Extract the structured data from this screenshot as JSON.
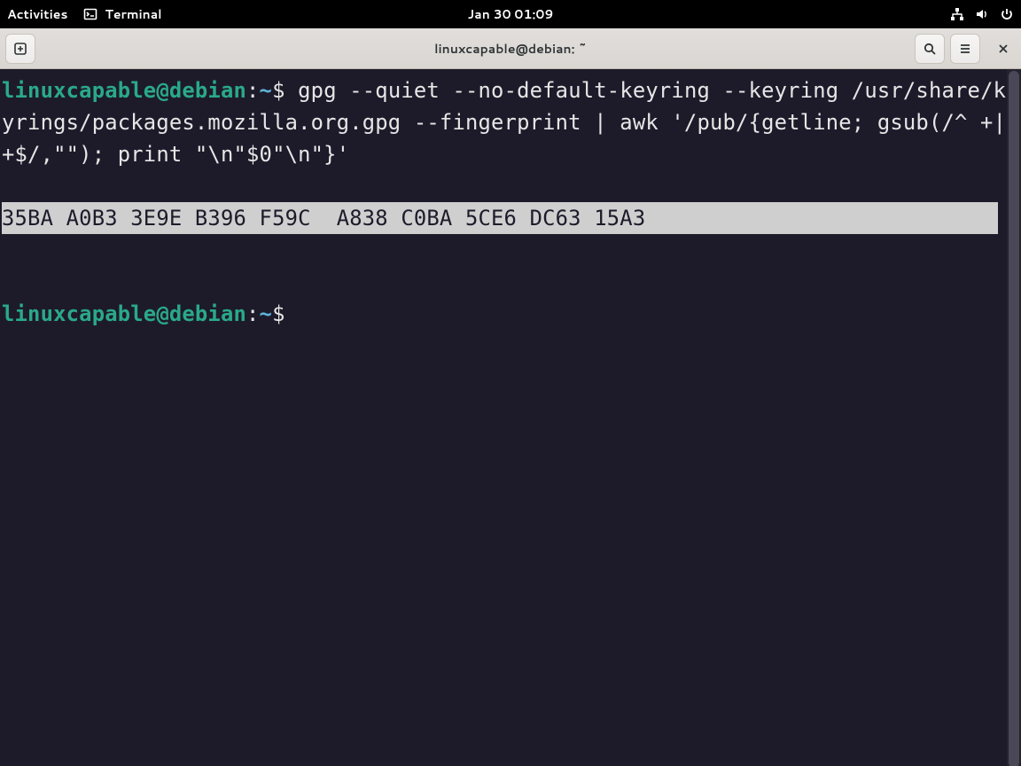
{
  "topbar": {
    "activities": "Activities",
    "app_label": "Terminal",
    "clock": "Jan 30  01:09"
  },
  "headerbar": {
    "title": "linuxcapable@debian: ~"
  },
  "terminal": {
    "prompt_user": "linuxcapable@debian",
    "prompt_sep": ":",
    "prompt_path": "~",
    "prompt_symbol": "$",
    "command": "gpg --quiet --no-default-keyring --keyring /usr/share/keyrings/packages.mozilla.org.gpg --fingerprint | awk '/pub/{getline; gsub(/^ +| +$/,\"\"); print \"\\n\"$0\"\\n\"}'",
    "output_fingerprint": "35BA A0B3 3E9E B396 F59C  A838 C0BA 5CE6 DC63 15A3"
  }
}
